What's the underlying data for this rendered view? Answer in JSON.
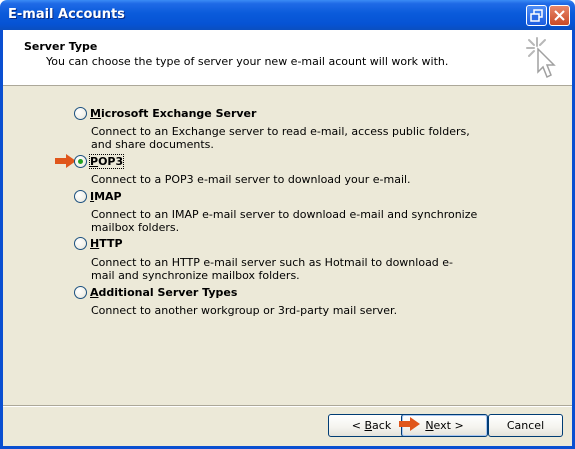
{
  "window": {
    "title": "E-mail Accounts"
  },
  "header": {
    "title": "Server Type",
    "subtitle": "You can choose the type of server your new e-mail acount will work with."
  },
  "options": [
    {
      "mnemonic": "M",
      "label_rest": "icrosoft Exchange Server",
      "description": "Connect to an Exchange server to read e-mail, access public folders, and share documents.",
      "selected": false
    },
    {
      "mnemonic": "P",
      "label_rest": "OP3",
      "description": "Connect to a POP3 e-mail server to download your e-mail.",
      "selected": true
    },
    {
      "mnemonic": "I",
      "label_rest": "MAP",
      "description": "Connect to an IMAP e-mail server to download e-mail and synchronize mailbox folders.",
      "selected": false
    },
    {
      "mnemonic": "H",
      "label_rest": "TTP",
      "description": "Connect to an HTTP e-mail server such as Hotmail to download e-mail and synchronize mailbox folders.",
      "selected": false
    },
    {
      "mnemonic": "A",
      "label_rest": "dditional Server Types",
      "description": "Connect to another workgroup or 3rd-party mail server.",
      "selected": false
    }
  ],
  "buttons": {
    "back_prefix": "< ",
    "back_mnemonic": "B",
    "back_rest": "ack",
    "next_mnemonic": "N",
    "next_rest": "ext >",
    "cancel": "Cancel"
  },
  "icons": {
    "restore": "restore-icon",
    "close": "close-icon",
    "wizard": "wizard-cursor-icon",
    "annotation": "orange-arrow-icon"
  },
  "colors": {
    "titlebar": "#0a5bdb",
    "dialog_bg": "#ece9d8",
    "arrow": "#e0561b",
    "radio_checked": "#21a121"
  }
}
